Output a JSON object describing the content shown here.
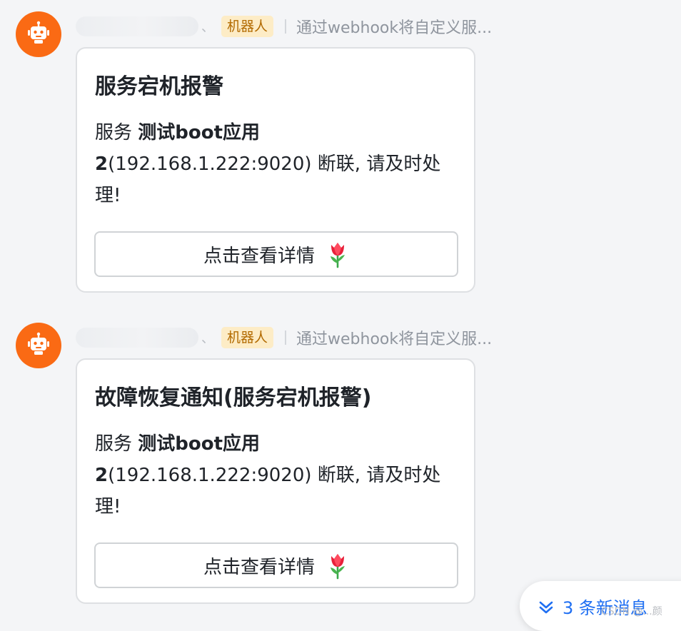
{
  "messages": [
    {
      "sender_suffix": "、",
      "bot_tag": "机器人",
      "subtitle": "通过webhook将自定义服...",
      "card": {
        "title": "服务宕机报警",
        "body_prefix": "服务 ",
        "body_bold": "测试boot应用2",
        "body_rest": "(192.168.1.222:9020) 断联, 请及时处理!",
        "button_label": "点击查看详情"
      }
    },
    {
      "sender_suffix": "、",
      "bot_tag": "机器人",
      "subtitle": "通过webhook将自定义服...",
      "card": {
        "title": "故障恢复通知(服务宕机报警)",
        "body_prefix": "服务 ",
        "body_bold": "测试boot应用2",
        "body_rest": "(192.168.1.222:9020) 断联, 请及时处理!",
        "button_label": "点击查看详情"
      }
    }
  ],
  "new_messages": {
    "label": "3 条新消息"
  },
  "watermark": "CSDN @...颜",
  "colors": {
    "avatar_bg": "#fa6a14",
    "bot_tag_bg": "#fdecc6",
    "bot_tag_text": "#b26a00",
    "link_blue": "#1f6ff2"
  },
  "icons": {
    "avatar": "robot-icon",
    "button_emoji": "tulip-icon",
    "new_messages": "double-chevron-down-icon"
  }
}
